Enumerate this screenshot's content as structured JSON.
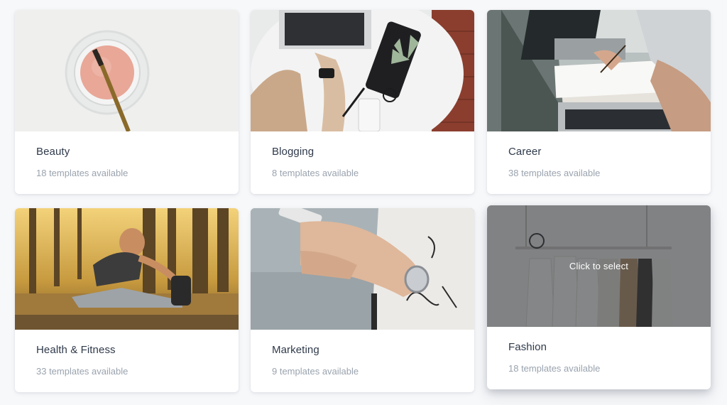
{
  "cards": [
    {
      "title": "Beauty",
      "count": "18 templates available",
      "image": "makeup-brush-photo"
    },
    {
      "title": "Blogging",
      "count": "8 templates available",
      "image": "laptop-desk-photo"
    },
    {
      "title": "Career",
      "count": "38 templates available",
      "image": "business-meeting-photo"
    },
    {
      "title": "Health & Fitness",
      "count": "33 templates available",
      "image": "forest-stretch-photo"
    },
    {
      "title": "Marketing",
      "count": "9 templates available",
      "image": "phone-hands-photo"
    },
    {
      "title": "Fashion",
      "count": "18 templates available",
      "image": "clothes-rack-photo",
      "hover_label": "Click to select"
    }
  ],
  "colors": {
    "title": "#2f3a4a",
    "subtitle": "#9aa3ae",
    "background": "#f7f8fa",
    "overlay": "rgba(40,44,50,0.55)"
  }
}
